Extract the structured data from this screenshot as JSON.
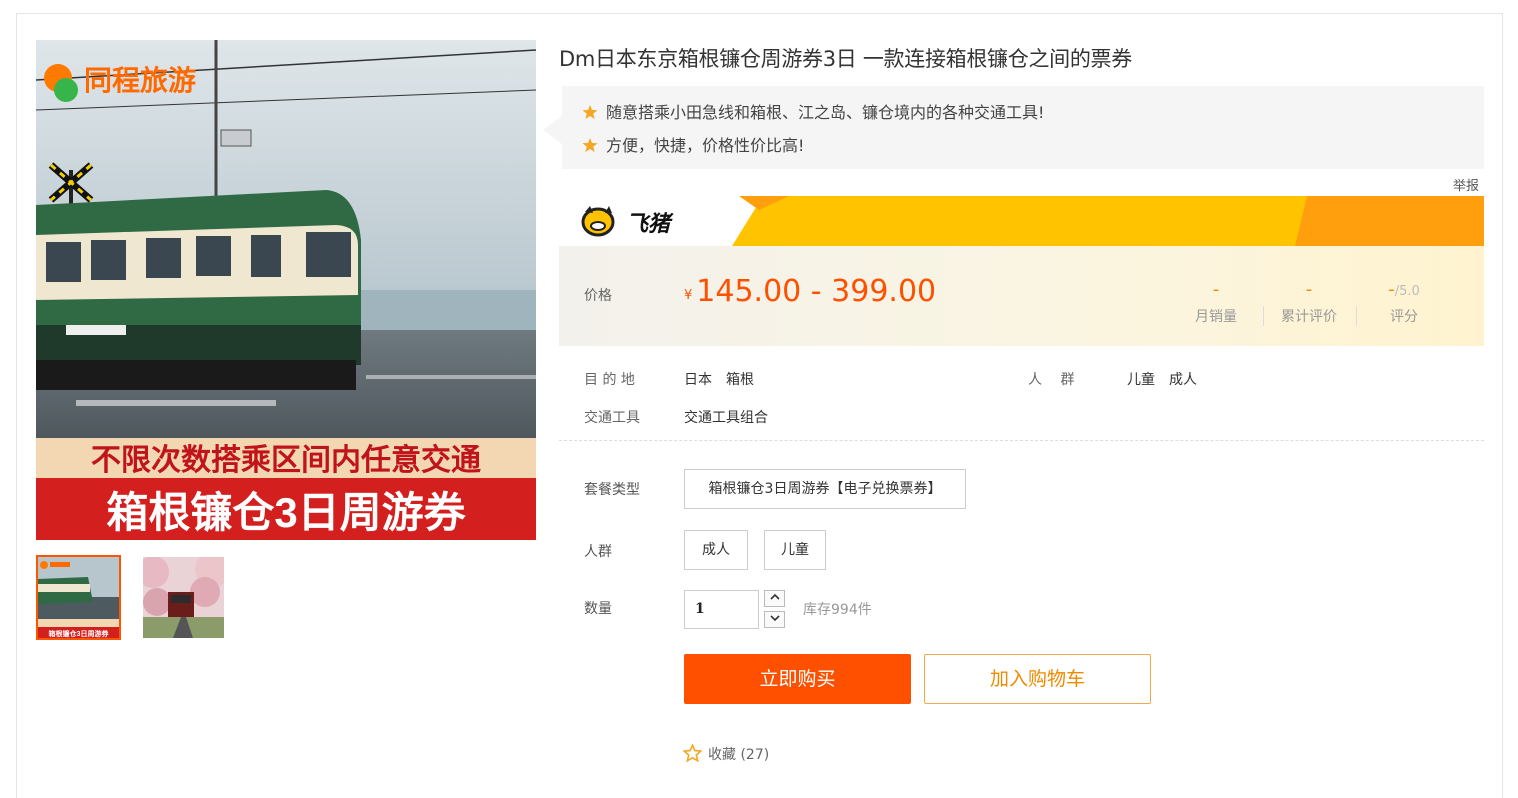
{
  "product": {
    "title": "Dm日本东京箱根镰仓周游券3日 一款连接箱根镰仓之间的票券",
    "features": [
      "随意搭乘小田急线和箱根、江之岛、镰仓境内的各种交通工具!",
      "方便，快捷，价格性价比高!"
    ],
    "report_label": "举报"
  },
  "gallery": {
    "main_image": {
      "brand_text": "同程旅游",
      "caption_line1": "不限次数搭乘区间内任意交通",
      "caption_line2": "箱根镰仓3日周游券"
    },
    "thumbnails": [
      {
        "caption": "箱根镰仓3日周游券",
        "selected": true
      },
      {
        "selected": false
      }
    ]
  },
  "banner": {
    "brand": "飞猪",
    "colors": {
      "yellow": "#ffc300",
      "orange": "#ff9f0e"
    }
  },
  "price": {
    "label": "价格",
    "currency": "¥",
    "range": "145.00 - 399.00",
    "stats": [
      {
        "value": "-",
        "suffix": "",
        "label": "月销量"
      },
      {
        "value": "-",
        "suffix": "",
        "label": "累计评价"
      },
      {
        "value": "-",
        "suffix": "/5.0",
        "label": "评分"
      }
    ]
  },
  "info": {
    "destination_label": "目 的 地",
    "destination_value": "日本　箱根",
    "crowd_label": "人　 群",
    "crowd_value": "儿童　成人",
    "transport_label": "交通工具",
    "transport_value": "交通工具组合"
  },
  "options": {
    "package_label": "套餐类型",
    "package_value": "箱根镰仓3日周游券【电子兑换票券】",
    "crowd_label": "人群",
    "crowd_options": [
      "成人",
      "儿童"
    ],
    "quantity_label": "数量",
    "quantity_value": "1",
    "stock_text": "库存994件"
  },
  "actions": {
    "buy_label": "立即购买",
    "cart_label": "加入购物车",
    "favorite_label": "收藏",
    "favorite_count": "(27)"
  },
  "colors": {
    "accent": "#ff5000",
    "stat_value": "#f08a00"
  }
}
